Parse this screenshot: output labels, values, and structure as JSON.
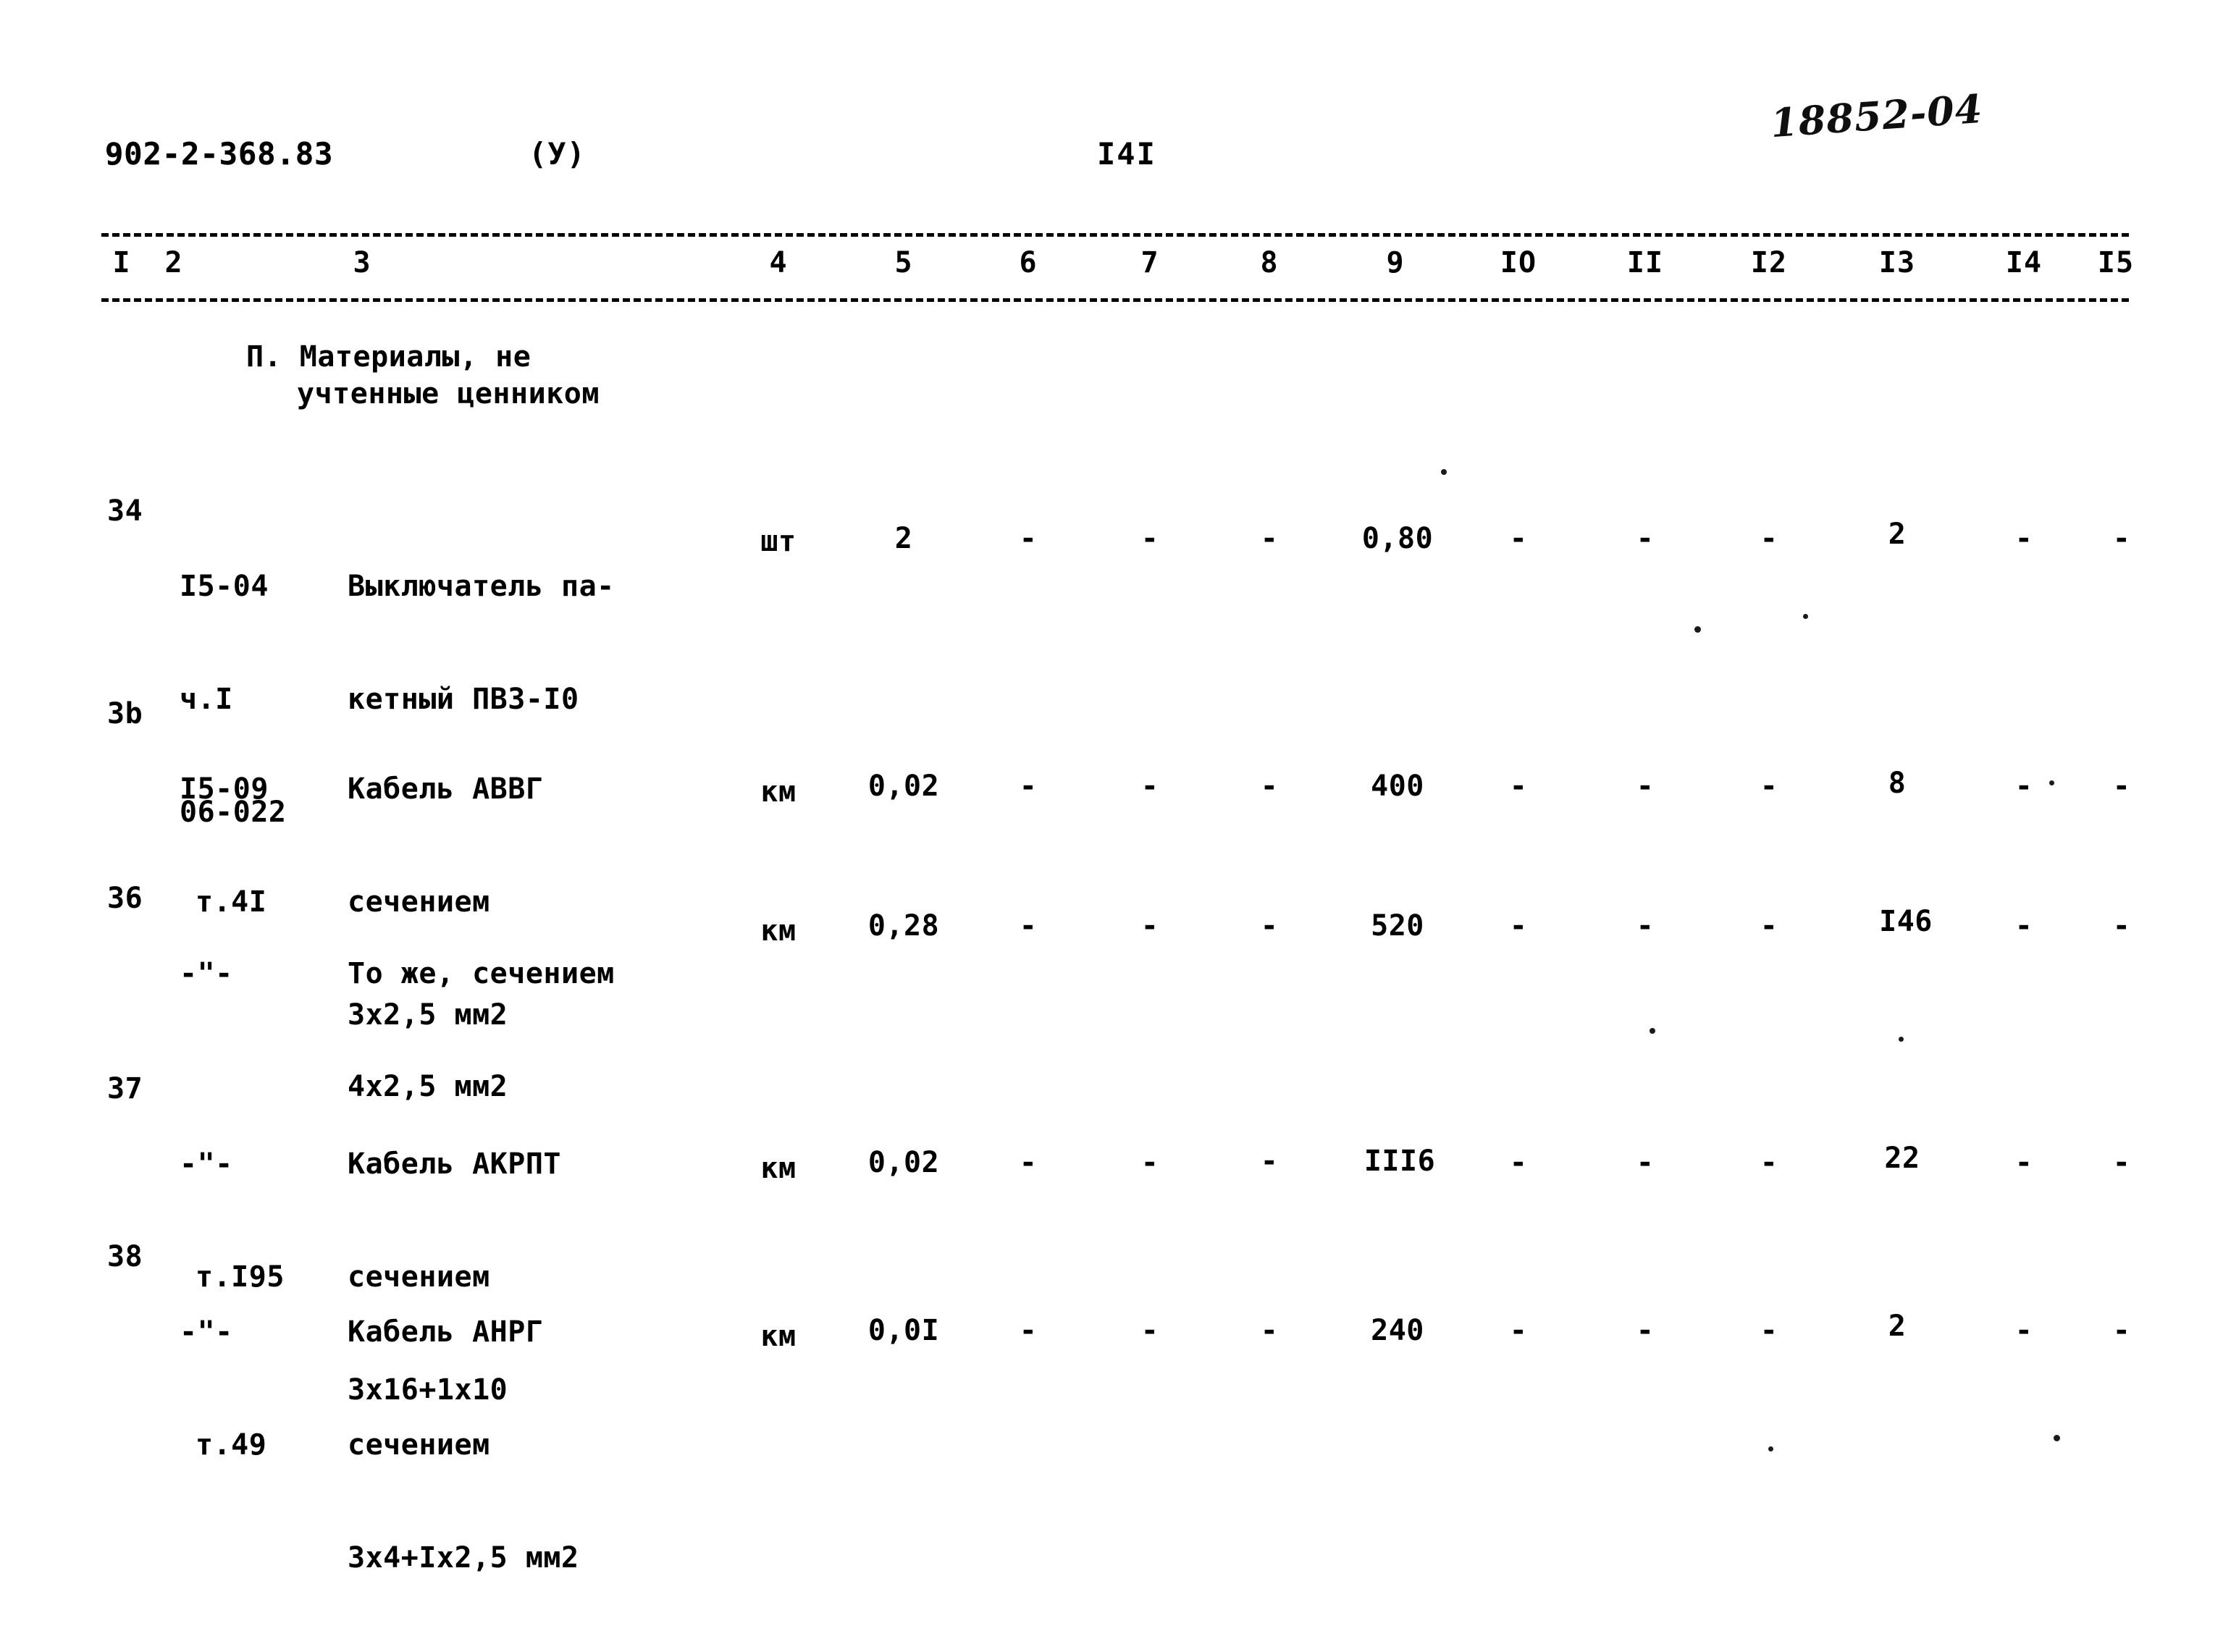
{
  "header": {
    "doc_code": "902-2-368.83",
    "variant": "(У)",
    "page_number": "I4I",
    "hand_note": "18852-04"
  },
  "table": {
    "column_headers": [
      "I",
      "2",
      "3",
      "4",
      "5",
      "6",
      "7",
      "8",
      "9",
      "IO",
      "II",
      "I2",
      "I3",
      "I4",
      "I5"
    ],
    "section_heading_line1": "П. Материалы, не",
    "section_heading_line2": "учтенные ценником",
    "rows": [
      {
        "num": "34",
        "code_line1": "I5-04",
        "code_line2": "ч.I",
        "code_line3": "06-022",
        "desc_line1": "Выключатель па-",
        "desc_line2": "кетный ПВЗ-I0",
        "desc_line3": "",
        "unit": "шт",
        "c5": "2",
        "c6": "-",
        "c7": "-",
        "c8": "-",
        "c9": "0,80",
        "c10": "-",
        "c11": "-",
        "c12": "-",
        "c13": "2",
        "c14": "-",
        "c15": "-"
      },
      {
        "num": "3b",
        "code_line1": "I5-09",
        "code_line2": "т.4I",
        "code_line3": "",
        "desc_line1": "Кабель АВВГ",
        "desc_line2": "сечением",
        "desc_line3": "3х2,5 мм2",
        "unit": "км",
        "c5": "0,02",
        "c6": "-",
        "c7": "-",
        "c8": "-",
        "c9": "400",
        "c10": "-",
        "c11": "-",
        "c12": "-",
        "c13": "8",
        "c14": "-",
        "c15": "-"
      },
      {
        "num": "36",
        "code_line1": "-\"-",
        "code_line2": "",
        "code_line3": "",
        "desc_line1": "То же, сечением",
        "desc_line2": "4х2,5 мм2",
        "desc_line3": "",
        "unit": "км",
        "c5": "0,28",
        "c6": "-",
        "c7": "-",
        "c8": "-",
        "c9": "520",
        "c10": "-",
        "c11": "-",
        "c12": "-",
        "c13": "I46",
        "c14": "-",
        "c15": "-"
      },
      {
        "num": "37",
        "code_line1": "-\"-",
        "code_line2": "т.I95",
        "code_line3": "",
        "desc_line1": "Кабель АКРПТ",
        "desc_line2": "сечением",
        "desc_line3": "3х16+1х10",
        "unit": "км",
        "c5": "0,02",
        "c6": "-",
        "c7": "-",
        "c8": "-",
        "c9": "III6",
        "c10": "-",
        "c11": "-",
        "c12": "-",
        "c13": "22",
        "c14": "-",
        "c15": "-"
      },
      {
        "num": "38",
        "code_line1": "-\"-",
        "code_line2": "т.49",
        "code_line3": "",
        "desc_line1": "Кабель АНРГ",
        "desc_line2": "сечением",
        "desc_line3": "3х4+Iх2,5 мм2",
        "unit": "км",
        "c5": "0,0I",
        "c6": "-",
        "c7": "-",
        "c8": "-",
        "c9": "240",
        "c10": "-",
        "c11": "-",
        "c12": "-",
        "c13": "2",
        "c14": "-",
        "c15": "-"
      }
    ]
  }
}
